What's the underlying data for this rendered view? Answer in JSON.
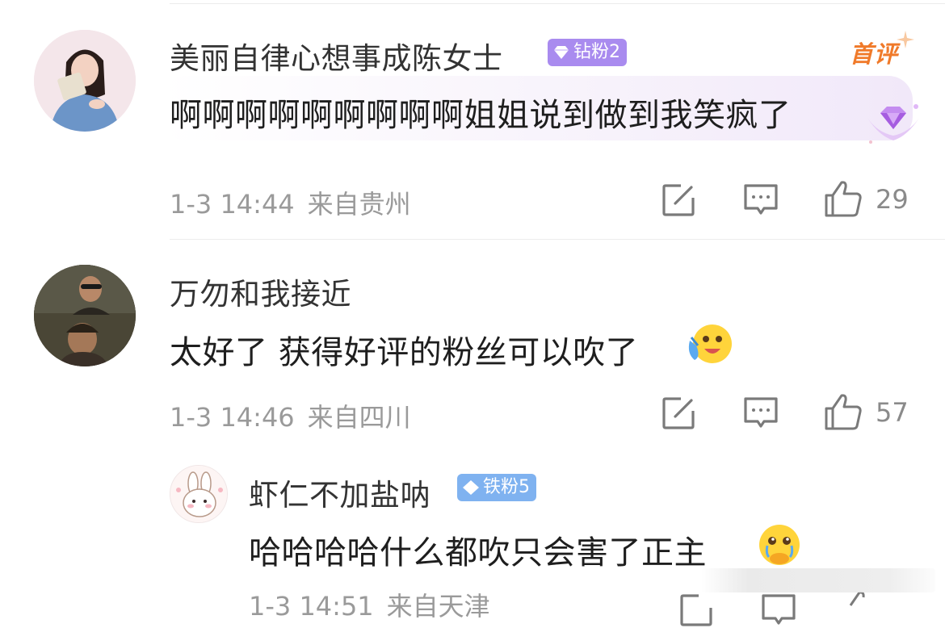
{
  "comments": [
    {
      "username": "美丽自律心想事成陈女士",
      "badge": "钻粉2",
      "first_tag": "首评",
      "text": "啊啊啊啊啊啊啊啊啊姐姐说到做到我笑疯了",
      "date": "1-3 14:44",
      "location": "来自贵州",
      "likes": "29"
    },
    {
      "username": "万勿和我接近",
      "text": "太好了 获得好评的粉丝可以吹了",
      "date": "1-3 14:46",
      "location": "来自四川",
      "likes": "57"
    }
  ],
  "reply": {
    "username": "虾仁不加盐呐",
    "badge": "铁粉5",
    "text": "哈哈哈哈什么都吹只会害了正主",
    "date_partial": "1-3 14:51",
    "location_partial": "来自天津"
  },
  "icons": {
    "repost": "repost-icon",
    "comment": "comment-icon",
    "like": "thumbs-up-icon"
  },
  "colors": {
    "diamond_badge": "#a98bef",
    "iron_badge": "#7fb2f0",
    "first_tag": "#f07a2a"
  }
}
